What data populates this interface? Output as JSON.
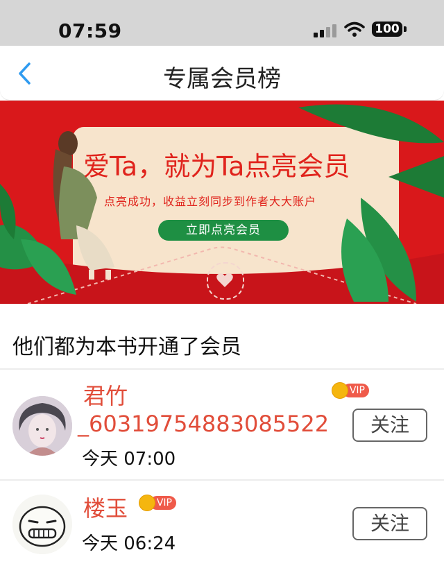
{
  "status_bar": {
    "time": "07:59",
    "battery": "100",
    "icons": [
      "signal-icon",
      "wifi-icon",
      "battery-icon"
    ]
  },
  "nav": {
    "title": "专属会员榜",
    "back_icon": "chevron-left-icon",
    "accent_color": "#2f9bf0"
  },
  "banner": {
    "title": "爱Ta，就为Ta点亮会员",
    "subtitle": "点亮成功，收益立刻同步到作者大大账户",
    "button_label": "立即点亮会员",
    "background_color": "#d9181b",
    "button_color": "#1e8f43"
  },
  "section": {
    "title": "他们都为本书开通了会员"
  },
  "members": [
    {
      "name_line1": "君竹",
      "name_line2": "_60319754883085522",
      "time": "今天 07:00",
      "vip_label": "VIP",
      "follow_label": "关注"
    },
    {
      "name_line1": "楼玉",
      "time": "今天 06:24",
      "vip_label": "VIP",
      "follow_label": "关注"
    }
  ]
}
